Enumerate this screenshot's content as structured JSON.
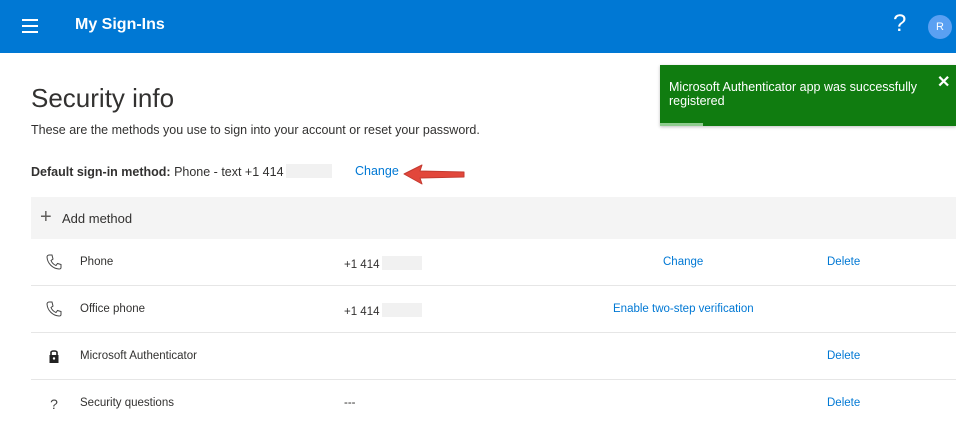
{
  "header": {
    "title": "My Sign-Ins",
    "help_glyph": "?",
    "avatar_initial": "R",
    "bg": "#0078d4"
  },
  "page": {
    "title": "Security info",
    "description": "These are the methods you use to sign into your account or reset your password.",
    "default_label": "Default sign-in method:",
    "default_value": "Phone - text +1 414",
    "default_change": "Change"
  },
  "toast": {
    "message": "Microsoft Authenticator app was successfully registered",
    "close": "✕",
    "color": "#107c10"
  },
  "methods": {
    "add_label": "Add method",
    "rows": [
      {
        "icon": "phone-icon",
        "name": "Phone",
        "value": "+1 414",
        "action": "Change",
        "delete": "Delete"
      },
      {
        "icon": "office-phone-icon",
        "name": "Office phone",
        "value": "+1 414",
        "action": "Enable two-step verification",
        "delete": ""
      },
      {
        "icon": "lock-icon",
        "name": "Microsoft Authenticator",
        "value": "",
        "action": "",
        "delete": "Delete"
      },
      {
        "icon": "question-icon",
        "name": "Security questions",
        "value": "---",
        "action": "",
        "delete": "Delete"
      }
    ]
  }
}
